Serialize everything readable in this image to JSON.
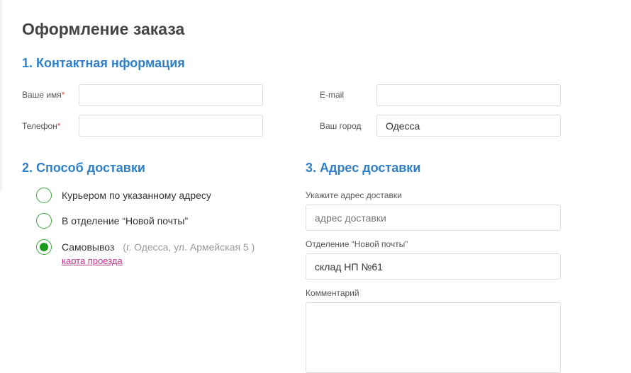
{
  "page": {
    "title": "Оформление заказа"
  },
  "contact": {
    "heading": "1. Контактная нформация",
    "name_label": "Ваше имя",
    "required_mark": "*",
    "phone_label": "Телефон",
    "email_label": "E-mail",
    "city_label": "Ваш город",
    "name_value": "",
    "phone_value": "",
    "email_value": "",
    "city_value": "Одесса"
  },
  "delivery": {
    "heading": "2. Способ доставки",
    "options": [
      {
        "label": "Курьером по указанному адресу",
        "selected": false
      },
      {
        "label": "В отделение “Новой почты”",
        "selected": false
      },
      {
        "label": "Самовывоз",
        "selected": true,
        "address": "(г. Одесса, ул. Армейская 5 )"
      }
    ],
    "map_link": "карта проезда"
  },
  "address": {
    "heading": "3. Адрес доставки",
    "address_label": "Укажите адрес доставки",
    "address_placeholder": "адрес доставки",
    "np_label": "Отделение “Новой почты”",
    "np_value": "склад НП №61",
    "comment_label": "Комментарий",
    "comment_value": ""
  },
  "colors": {
    "accent": "#2f7fc9",
    "radio": "#1a9a1a",
    "link": "#c2378a",
    "required": "#d9534f"
  }
}
